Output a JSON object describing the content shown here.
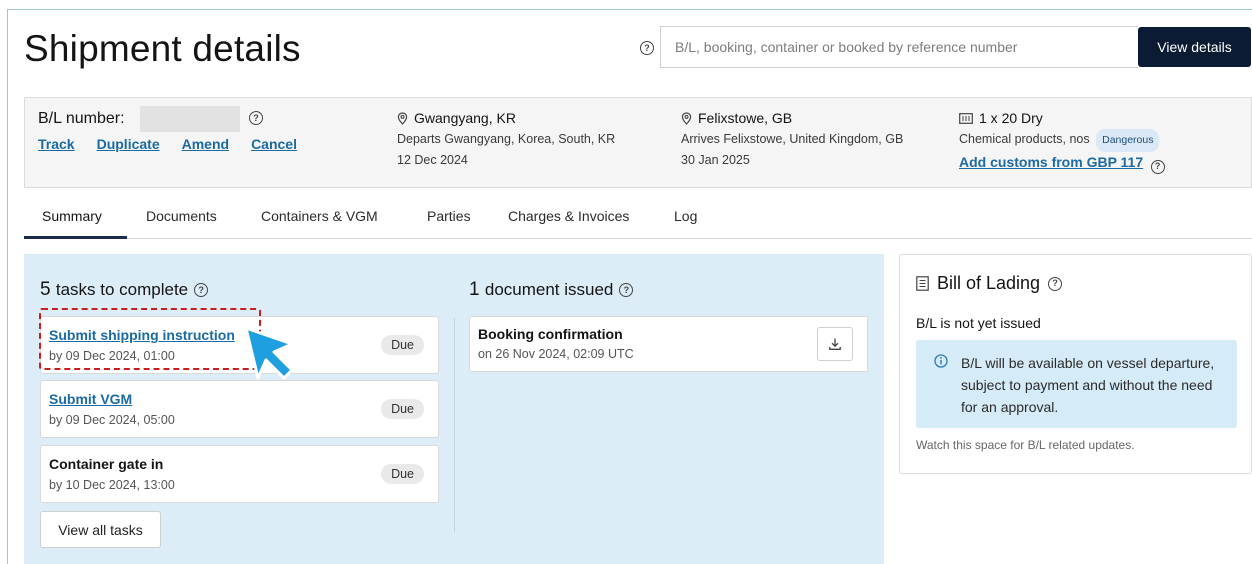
{
  "header": {
    "title": "Shipment details",
    "search_placeholder": "B/L, booking, container or booked by reference number",
    "view_button": "View details"
  },
  "summary": {
    "bl_label": "B/L number:",
    "actions": [
      "Track",
      "Duplicate",
      "Amend",
      "Cancel"
    ],
    "origin": {
      "port": "Gwangyang, KR",
      "detail": "Departs Gwangyang, Korea, South, KR",
      "date": "12 Dec 2024"
    },
    "destination": {
      "port": "Felixstowe, GB",
      "detail": "Arrives Felixstowe, United Kingdom, GB",
      "date": "30 Jan 2025"
    },
    "cargo": {
      "container": "1 x 20 Dry",
      "commodity": "Chemical products, nos",
      "badge": "Dangerous",
      "customs_link": "Add customs from GBP 117"
    }
  },
  "tabs": [
    "Summary",
    "Documents",
    "Containers & VGM",
    "Parties",
    "Charges & Invoices",
    "Log"
  ],
  "tasks": {
    "count": "5",
    "title_suffix": "tasks to complete",
    "items": [
      {
        "name": "Submit shipping instruction",
        "date": "by 09 Dec 2024, 01:00",
        "status": "Due"
      },
      {
        "name": "Submit VGM",
        "date": "by 09 Dec 2024, 05:00",
        "status": "Due"
      },
      {
        "name": "Container gate in",
        "date": "by 10 Dec 2024, 13:00",
        "status": "Due"
      }
    ],
    "view_all": "View all tasks"
  },
  "documents": {
    "count": "1",
    "title_suffix": "document issued",
    "items": [
      {
        "name": "Booking confirmation",
        "date": "on 26 Nov 2024, 02:09 UTC"
      }
    ]
  },
  "bill_of_lading": {
    "title": "Bill of Lading",
    "status": "B/L is not yet issued",
    "info": "B/L will be available on vessel departure, subject to payment and without the need for an approval.",
    "watch": "Watch this space for B/L related updates."
  },
  "colors": {
    "link": "#1c6aa3",
    "primary_button": "#0b1b33",
    "panel_bg": "#dcedf7",
    "highlight": "#cc1d1d",
    "cursor": "#1ea0e0"
  }
}
